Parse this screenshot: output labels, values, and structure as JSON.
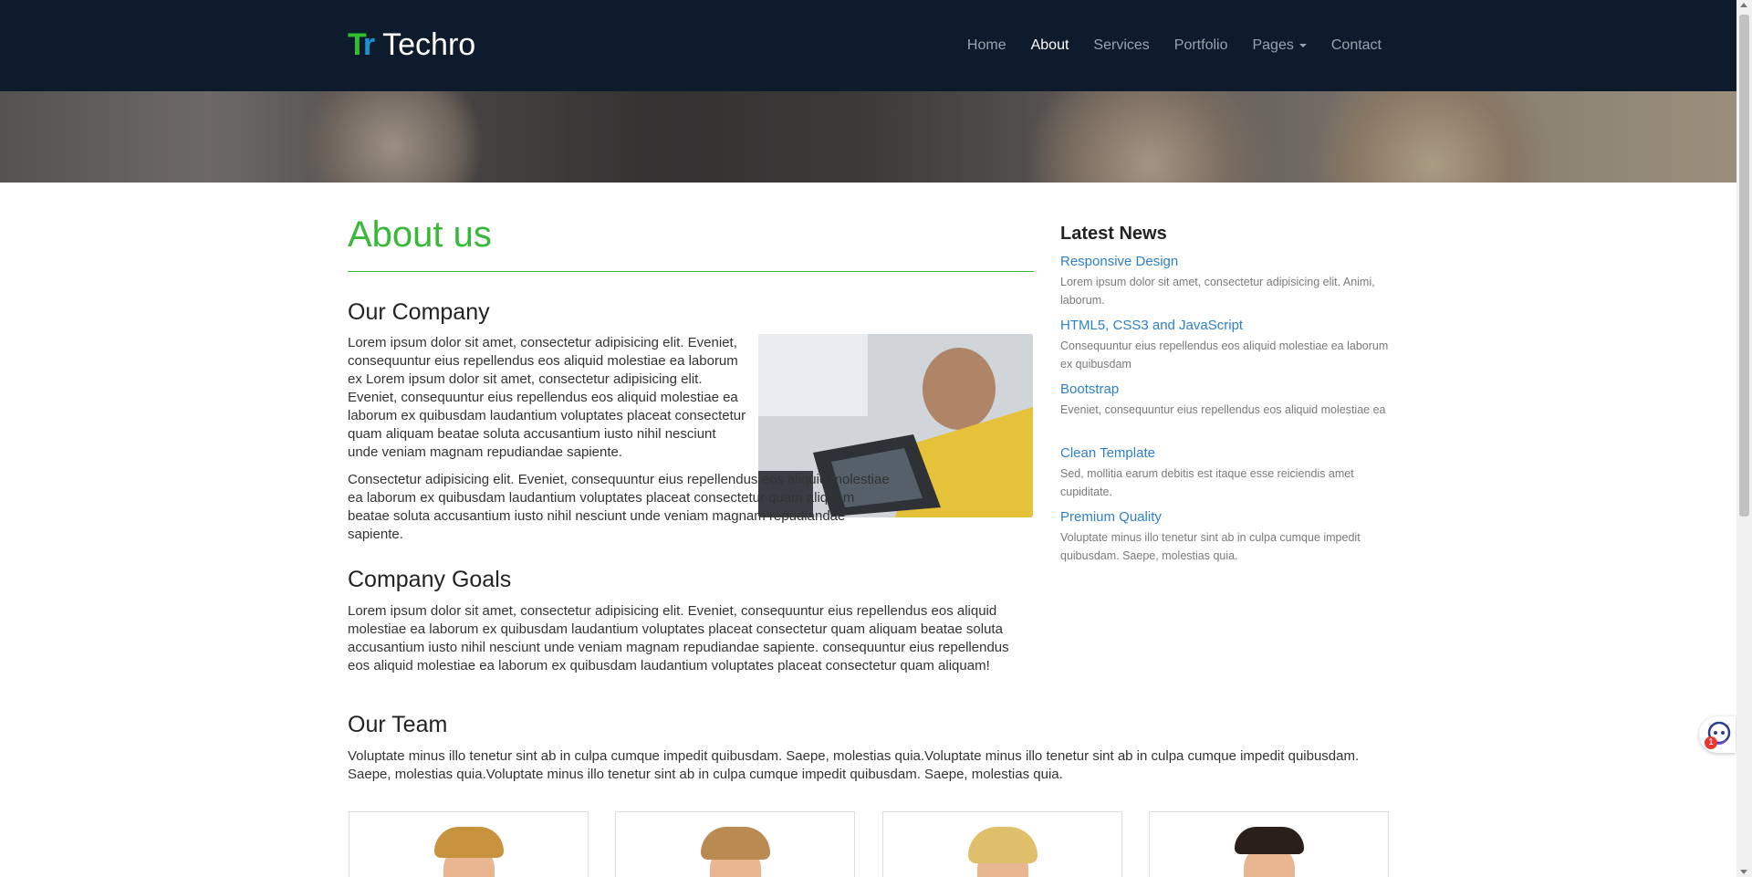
{
  "brand": {
    "mark": "Tr",
    "name": "Techro"
  },
  "nav": {
    "items": [
      {
        "label": "Home"
      },
      {
        "label": "About"
      },
      {
        "label": "Services"
      },
      {
        "label": "Portfolio"
      },
      {
        "label": "Pages"
      },
      {
        "label": "Contact"
      }
    ],
    "active": "About"
  },
  "main": {
    "title": "About us",
    "company": {
      "heading": "Our Company",
      "para1": "Lorem ipsum dolor sit amet, consectetur adipisicing elit. Eveniet, consequuntur eius repellendus eos aliquid molestiae ea laborum ex Lorem ipsum dolor sit amet, consectetur adipisicing elit. Eveniet, consequuntur eius repellendus eos aliquid molestiae ea laborum ex quibusdam laudantium voluptates placeat consectetur quam aliquam beatae soluta accusantium iusto nihil nesciunt unde veniam magnam repudiandae sapiente.",
      "para2": "Consectetur adipisicing elit. Eveniet, consequuntur eius repellendus eos aliquid molestiae ea laborum ex quibusdam laudantium voluptates placeat consectetur quam aliquam beatae soluta accusantium iusto nihil nesciunt unde veniam magnam repudiandae sapiente."
    },
    "goals": {
      "heading": "Company Goals",
      "para": "Lorem ipsum dolor sit amet, consectetur adipisicing elit. Eveniet, consequuntur eius repellendus eos aliquid molestiae ea laborum ex quibusdam laudantium voluptates placeat consectetur quam aliquam beatae soluta accusantium iusto nihil nesciunt unde veniam magnam repudiandae sapiente. consequuntur eius repellendus eos aliquid molestiae ea laborum ex quibusdam laudantium voluptates placeat consectetur quam aliquam!"
    }
  },
  "team": {
    "heading": "Our Team",
    "para": "Voluptate minus illo tenetur sint ab in culpa cumque impedit quibusdam. Saepe, molestias quia.Voluptate minus illo tenetur sint ab in culpa cumque impedit quibusdam. Saepe, molestias quia.Voluptate minus illo tenetur sint ab in culpa cumque impedit quibusdam. Saepe, molestias quia."
  },
  "sidebar": {
    "title": "Latest News",
    "news": [
      {
        "title": "Responsive Design",
        "text": "Lorem ipsum dolor sit amet, consectetur adipisicing elit. Animi, laborum."
      },
      {
        "title": "HTML5, CSS3 and JavaScript",
        "text": "Consequuntur eius repellendus eos aliquid molestiae ea laborum ex quibusdam"
      },
      {
        "title": "Bootstrap",
        "text": "Eveniet, consequuntur eius repellendus eos aliquid molestiae ea"
      },
      {
        "title": "Clean Template",
        "text": "Sed, mollitia earum debitis est itaque esse reiciendis amet cupiditate."
      },
      {
        "title": "Premium Quality",
        "text": "Voluptate minus illo tenetur sint ab in culpa cumque impedit quibusdam. Saepe, molestias quia."
      }
    ]
  },
  "widget": {
    "badge": "1",
    "icon": "support-chat-icon"
  },
  "colors": {
    "navbar": "#0e1b2d",
    "accent_green": "#38b838",
    "link_blue": "#2e80c8"
  }
}
